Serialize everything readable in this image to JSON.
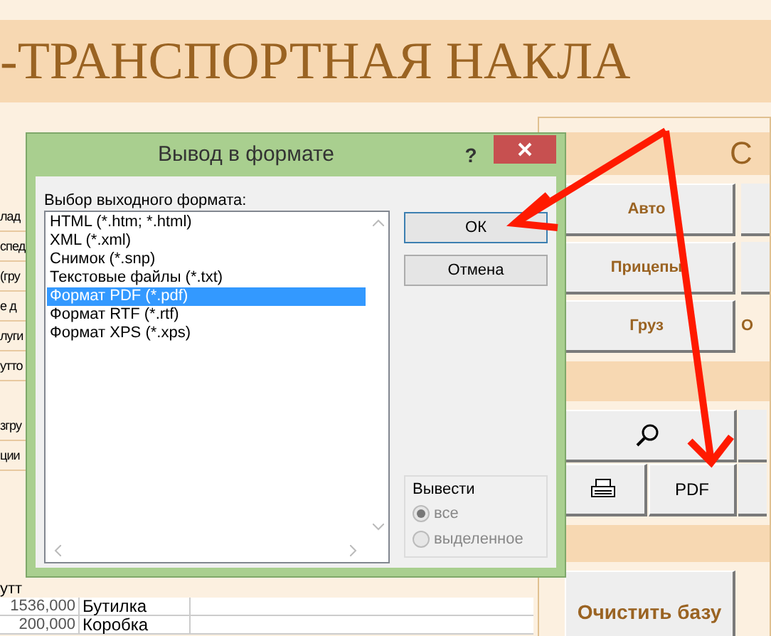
{
  "app_title": "-ТРАНСПОРТНАЯ НАКЛА",
  "form_labels": [
    "лад",
    "спед",
    "(гру",
    "е д",
    "луги",
    "утто",
    "згру",
    "ции"
  ],
  "table_header": "утт",
  "table_rows": [
    {
      "amount": "1536,000",
      "package": "Бутилка"
    },
    {
      "amount": "200,000",
      "package": "Коробка"
    }
  ],
  "right_panel": {
    "header": "С",
    "buttons": [
      "Авто",
      "Прицепы",
      "Груз"
    ],
    "side_label": "О",
    "pdf_button": "PDF",
    "clear_button": "Очистить базу"
  },
  "dialog": {
    "title": "Вывод в формате",
    "help": "?",
    "list_label": "Выбор выходного формата:",
    "formats": [
      {
        "label": "HTML (*.htm; *.html)",
        "selected": false
      },
      {
        "label": "XML (*.xml)",
        "selected": false
      },
      {
        "label": "Снимок (*.snp)",
        "selected": false
      },
      {
        "label": "Текстовые файлы (*.txt)",
        "selected": false
      },
      {
        "label": "Формат PDF (*.pdf)",
        "selected": true
      },
      {
        "label": "Формат RTF (*.rtf)",
        "selected": false
      },
      {
        "label": "Формат XPS (*.xps)",
        "selected": false
      }
    ],
    "buttons": [
      "ОК",
      "Отмена"
    ],
    "output_group": {
      "title": "Вывести",
      "disabled": true,
      "options": [
        {
          "label": "все",
          "selected": true
        },
        {
          "label": "выделенное",
          "selected": false
        }
      ]
    }
  }
}
